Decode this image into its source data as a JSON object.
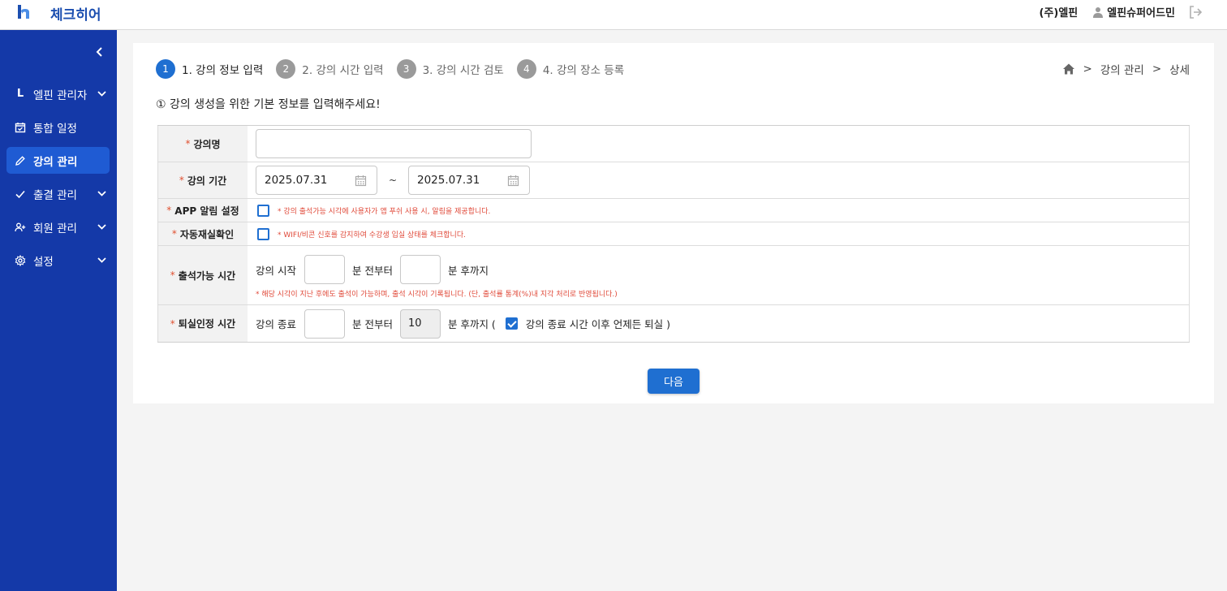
{
  "header": {
    "brand": "체크히어",
    "company": "(주)엘핀",
    "username": "엘핀슈퍼어드민"
  },
  "sidebar": {
    "items": [
      {
        "icon": "L",
        "label": "엘핀 관리자",
        "expandable": true,
        "active": false
      },
      {
        "icon": "calendar-check-icon",
        "label": "통합 일정",
        "expandable": false,
        "active": false
      },
      {
        "icon": "pencil-icon",
        "label": "강의 관리",
        "expandable": false,
        "active": true
      },
      {
        "icon": "check-icon",
        "label": "출결 관리",
        "expandable": true,
        "active": false
      },
      {
        "icon": "user-plus-icon",
        "label": "회원 관리",
        "expandable": true,
        "active": false
      },
      {
        "icon": "gear-icon",
        "label": "설정",
        "expandable": true,
        "active": false
      }
    ]
  },
  "steps": [
    {
      "num": "1",
      "label": "1. 강의 정보 입력",
      "active": true
    },
    {
      "num": "2",
      "label": "2. 강의 시간 입력",
      "active": false
    },
    {
      "num": "3",
      "label": "3. 강의 시간 검토",
      "active": false
    },
    {
      "num": "4",
      "label": "4. 강의 장소 등록",
      "active": false
    }
  ],
  "breadcrumb": {
    "sep1": ">",
    "item1": "강의 관리",
    "sep2": ">",
    "item2": "상세"
  },
  "intro": "① 강의 생성을 위한 기본 정보를 입력해주세요!",
  "form": {
    "required_mark": "*",
    "course_name": {
      "label": "강의명",
      "value": ""
    },
    "course_period": {
      "label": "강의 기간",
      "start": "2025.07.31",
      "tilde": "~",
      "end": "2025.07.31"
    },
    "app_alarm": {
      "label": "APP 알림 설정",
      "checked": false,
      "hint": "* 강의 출석가능 시각에 사용자가 앱 푸쉬 사용 시, 알림을 제공합니다."
    },
    "auto_check": {
      "label": "자동재실확인",
      "checked": false,
      "hint": "* WIFI/비콘 신호를 감지하여 수강생 입실 상태를 체크합니다."
    },
    "attend_time": {
      "label": "출석가능 시간",
      "prefix": "강의 시작",
      "before_value": "",
      "mid": "분 전부터",
      "after_value": "",
      "suffix": "분 후까지",
      "hint": "* 해당 시각이 지난 후에도 출석이 가능하며, 출석 시각이 기록됩니다. (단, 출석률 통계(%)내 지각 처리로 반영됩니다.)"
    },
    "leave_time": {
      "label": "퇴실인정 시간",
      "prefix": "강의 종료",
      "before_value": "",
      "mid": "분 전부터",
      "after_value": "10",
      "suffix": "분 후까지 (",
      "checkbox_checked": true,
      "checkbox_label": "강의 종료 시간 이후 언제든 퇴실 )"
    }
  },
  "next_button": "다음",
  "colors": {
    "sidebar_bg": "#1439a8",
    "sidebar_active": "#1f5bd3",
    "primary": "#1f6fd1",
    "required": "#e05030"
  }
}
